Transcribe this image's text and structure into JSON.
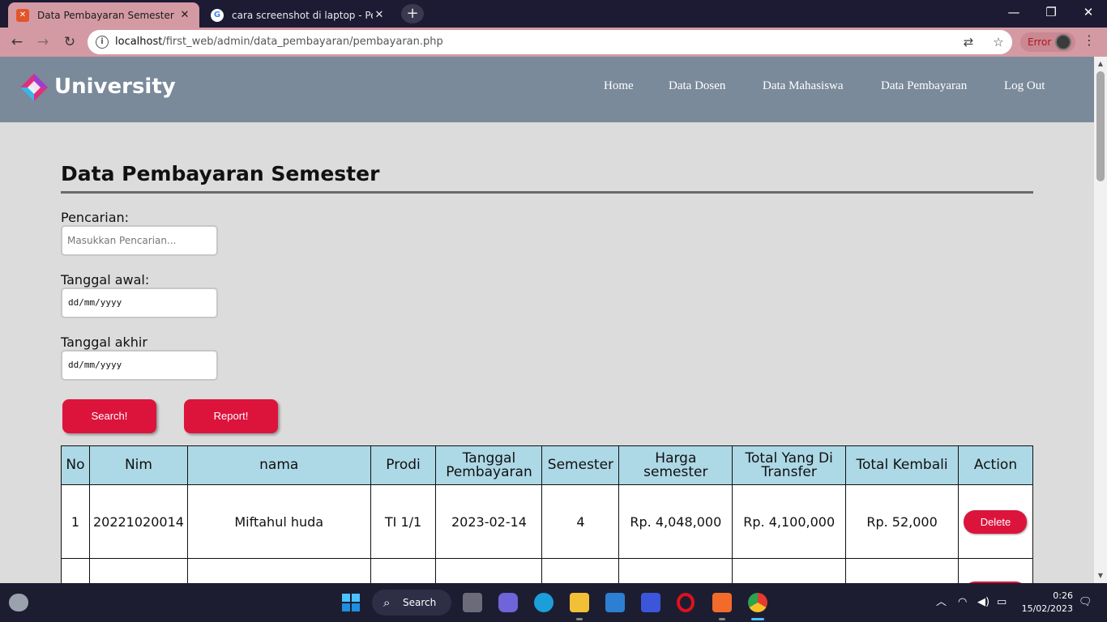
{
  "browser": {
    "tabs": [
      {
        "title": "Data Pembayaran Semester",
        "active": true,
        "favicon": "xampp-icon"
      },
      {
        "title": "cara screenshot di laptop - Peneli",
        "active": false,
        "favicon": "google-icon"
      }
    ],
    "url_host": "localhost",
    "url_path": "/first_web/admin/data_pembayaran/pembayaran.php",
    "error_label": "Error"
  },
  "site": {
    "brand": "University",
    "menu": [
      "Home",
      "Data Dosen",
      "Data Mahasiswa",
      "Data Pembayaran",
      "Log Out"
    ]
  },
  "page": {
    "title": "Data Pembayaran Semester",
    "search_label": "Pencarian:",
    "search_placeholder": "Masukkan Pencarian...",
    "start_label": "Tanggal awal:",
    "start_value": "dd/mm/yyyy",
    "end_label": "Tanggal akhir",
    "end_value": "dd/mm/yyyy",
    "search_button": "Search!",
    "report_button": "Report!"
  },
  "table": {
    "headers": [
      "No",
      "Nim",
      "nama",
      "Prodi",
      "Tanggal Pembayaran",
      "Semester",
      "Harga semester",
      "Total Yang Di Transfer",
      "Total Kembali",
      "Action"
    ],
    "rows": [
      {
        "no": "1",
        "nim": "20221020014",
        "nama": "Miftahul huda",
        "prodi": "TI 1/1",
        "tanggal": "2023-02-14",
        "semester": "4",
        "harga": "Rp. 4,048,000",
        "transfer": "Rp. 4,100,000",
        "kembali": "Rp. 52,000",
        "action": "Delete"
      }
    ]
  },
  "taskbar": {
    "search_label": "Search",
    "time": "0:26",
    "date": "15/02/2023"
  },
  "colors": {
    "accent": "#dc143c",
    "nav_bg": "#7a8a9a",
    "table_header": "#add8e6",
    "chrome_frame": "#d49aa3"
  }
}
